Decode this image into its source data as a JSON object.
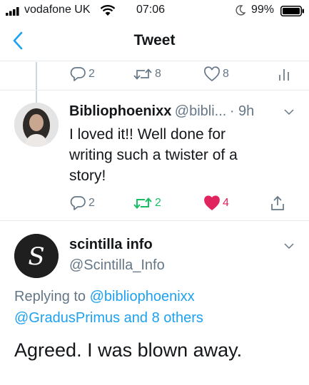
{
  "status_bar": {
    "carrier": "vodafone UK",
    "time": "07:06",
    "battery": "99%"
  },
  "nav": {
    "title": "Tweet"
  },
  "parent_actions": {
    "replies": "2",
    "retweets": "8",
    "likes": "8"
  },
  "reply_tweet": {
    "name": "Bibliophoenixx",
    "handle": "@bibli...",
    "time": "· 9h",
    "text_line1": "I loved it!! Well done for",
    "text_line2": "writing such a twister of a",
    "text_line3": "story!",
    "actions": {
      "replies": "2",
      "retweets": "2",
      "likes": "4"
    }
  },
  "focused_tweet": {
    "name": "scintilla info",
    "handle": "@Scintilla_Info",
    "replying_prefix": "Replying to",
    "replying_user": "@bibliophoenixx",
    "replying_line2": "@GradusPrimus and 8 others",
    "text": "Agreed. I was blown away.",
    "avatar_letter": "S"
  },
  "colors": {
    "accent": "#1da1f2",
    "retweet_green": "#17bf63",
    "like_red": "#e0245e",
    "gray": "#657786"
  }
}
